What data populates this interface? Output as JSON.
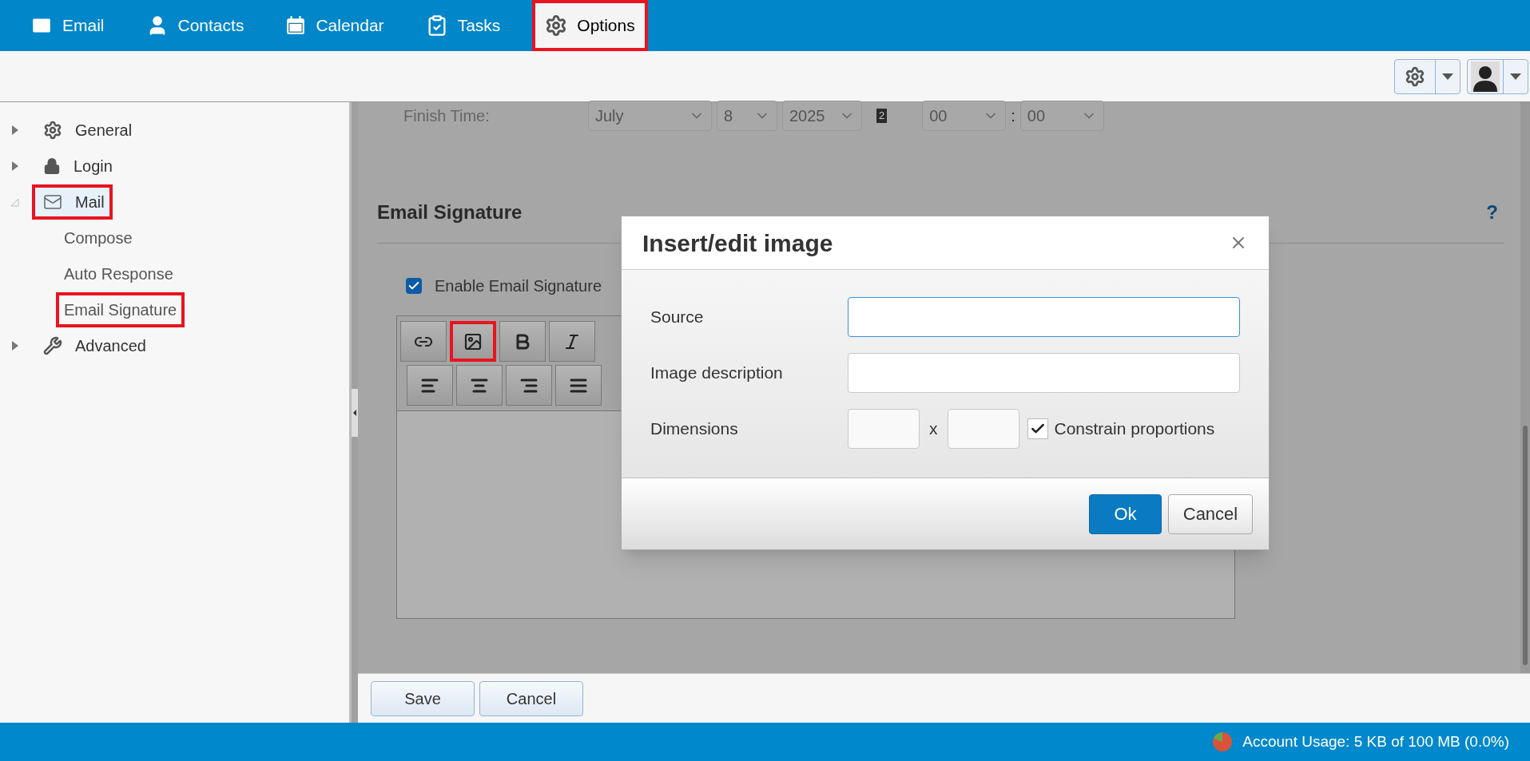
{
  "nav": {
    "tabs": [
      {
        "label": "Email",
        "kind": "mail",
        "selected": false,
        "highlighted": false
      },
      {
        "label": "Contacts",
        "kind": "contacts",
        "selected": false,
        "highlighted": false
      },
      {
        "label": "Calendar",
        "kind": "calendar",
        "selected": false,
        "highlighted": false
      },
      {
        "label": "Tasks",
        "kind": "tasks",
        "selected": false,
        "highlighted": false
      },
      {
        "label": "Options",
        "kind": "options",
        "selected": true,
        "highlighted": true
      }
    ]
  },
  "sidebar": {
    "items": [
      {
        "label": "General",
        "kind": "general",
        "expanded": false,
        "selected": false,
        "highlighted": false
      },
      {
        "label": "Login",
        "kind": "login",
        "expanded": false,
        "selected": false,
        "highlighted": false
      },
      {
        "label": "Mail",
        "kind": "mail",
        "expanded": true,
        "selected": true,
        "highlighted": true,
        "children": [
          {
            "label": "Compose",
            "selected": false,
            "highlighted": false
          },
          {
            "label": "Auto Response",
            "selected": false,
            "highlighted": false
          },
          {
            "label": "Email Signature",
            "selected": false,
            "highlighted": true
          }
        ]
      },
      {
        "label": "Advanced",
        "kind": "advanced",
        "expanded": false,
        "selected": false,
        "highlighted": false
      }
    ]
  },
  "settings": {
    "finish_time": {
      "label": "Finish Time:",
      "month": "July",
      "day": "8",
      "year": "2025",
      "calendar_badge": "2",
      "hour": "00",
      "separator": ":",
      "minute": "00"
    },
    "section_title": "Email Signature",
    "help": "?",
    "enable_signature": {
      "label": "Enable Email Signature",
      "checked": true
    },
    "toolbar": [
      [
        {
          "kind": "link",
          "highlighted": false
        },
        {
          "kind": "image",
          "highlighted": true
        },
        {
          "kind": "bold",
          "highlighted": false
        },
        {
          "kind": "italic",
          "highlighted": false
        }
      ],
      [
        {
          "kind": "align-left",
          "highlighted": false
        },
        {
          "kind": "align-center",
          "highlighted": false
        },
        {
          "kind": "align-right",
          "highlighted": false
        },
        {
          "kind": "justify",
          "highlighted": false
        }
      ]
    ]
  },
  "dialog": {
    "title": "Insert/edit image",
    "fields": [
      {
        "label": "Source",
        "focused": true
      },
      {
        "label": "Image description",
        "focused": false
      }
    ],
    "dimensions": {
      "label": "Dimensions",
      "separator": "x",
      "constrain": {
        "label": "Constrain proportions",
        "checked": true
      }
    },
    "buttons": [
      {
        "label": "Ok",
        "primary": true
      },
      {
        "label": "Cancel",
        "primary": false
      }
    ]
  },
  "footer_buttons": [
    "Save",
    "Cancel"
  ],
  "status_bar": {
    "usage": "Account Usage: 5 KB of 100 MB (0.0%)"
  }
}
